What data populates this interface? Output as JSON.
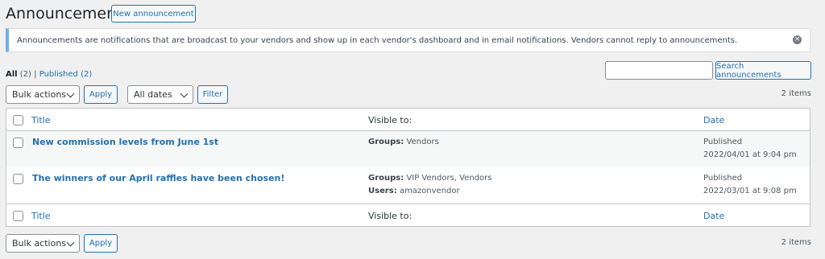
{
  "page": {
    "title": "Announcements",
    "new_button": "New announcement"
  },
  "notice": {
    "text": "Announcements are notifications that are broadcast to your vendors and show up in each vendor's dashboard and in email notifications. Vendors cannot reply to announcements.",
    "dismiss_icon": "dismiss-icon"
  },
  "views": {
    "all_label": "All",
    "all_count": "(2)",
    "separator": "|",
    "published_label": "Published",
    "published_count": "(2)"
  },
  "search": {
    "placeholder": "",
    "button": "Search announcements"
  },
  "tablenav_top": {
    "bulk_actions": "Bulk actions",
    "apply": "Apply",
    "dates": "All dates",
    "filter": "Filter",
    "items": "2 items"
  },
  "table": {
    "headers": {
      "title": "Title",
      "visible": "Visible to:",
      "date": "Date"
    },
    "rows": [
      {
        "title": "New commission levels from June 1st",
        "groups_label": "Groups:",
        "groups": "Vendors",
        "users_label": "",
        "users": "",
        "status": "Published",
        "date": "2022/04/01 at 9:04 pm"
      },
      {
        "title": "The winners of our April raffles have been chosen!",
        "groups_label": "Groups:",
        "groups": "VIP Vendors, Vendors",
        "users_label": "Users:",
        "users": "amazonvendor",
        "status": "Published",
        "date": "2022/03/01 at 9:08 pm"
      }
    ]
  },
  "tablenav_bottom": {
    "bulk_actions": "Bulk actions",
    "apply": "Apply",
    "items": "2 items"
  }
}
